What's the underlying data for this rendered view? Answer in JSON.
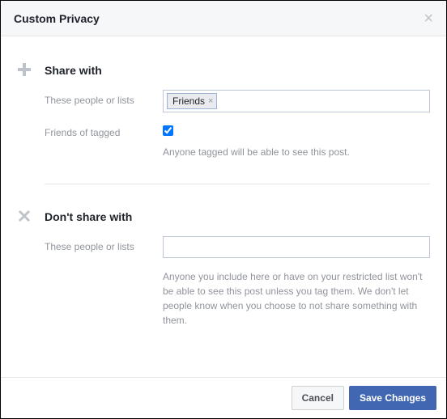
{
  "header": {
    "title": "Custom Privacy"
  },
  "share": {
    "title": "Share with",
    "people_label": "These people or lists",
    "chip": "Friends",
    "friends_label": "Friends of tagged",
    "friends_checked": true,
    "hint": "Anyone tagged will be able to see this post."
  },
  "dont_share": {
    "title": "Don't share with",
    "people_label": "These people or lists",
    "hint": "Anyone you include here or have on your restricted list won't be able to see this post unless you tag them. We don't let people know when you choose to not share something with them."
  },
  "footer": {
    "cancel": "Cancel",
    "save": "Save Changes"
  }
}
